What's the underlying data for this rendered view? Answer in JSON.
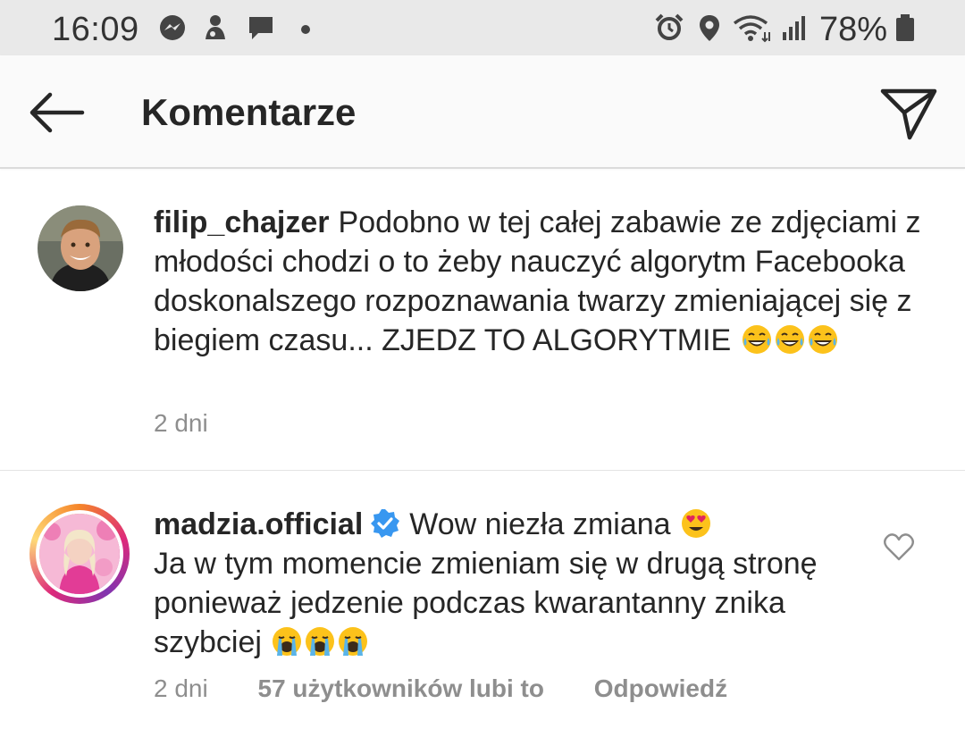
{
  "status_bar": {
    "time": "16:09",
    "battery": "78%",
    "icons": [
      "messenger-icon",
      "app-notification-icon",
      "message-icon",
      "dot-icon",
      "alarm-icon",
      "location-icon",
      "wifi-icon",
      "signal-icon",
      "battery-icon"
    ]
  },
  "header": {
    "title": "Komentarze",
    "back_icon": "back-arrow-icon",
    "share_icon": "send-icon"
  },
  "comments": [
    {
      "username": "filip_chajzer",
      "text": "Podobno w tej całej zabawie ze zdjęciami z młodości chodzi o to żeby nauczyć algorytm Facebooka doskonalszego rozpoznawania twarzy zmieniającej się z biegiem czasu... ZJEDZ TO ALGORYTMIE",
      "emojis": [
        "tears-of-joy-emoji",
        "tears-of-joy-emoji",
        "tears-of-joy-emoji"
      ],
      "time": "2 dni"
    },
    {
      "username": "madzia.official",
      "verified": true,
      "text_line1": "Wow niezła zmiana",
      "emoji_line1": [
        "heart-eyes-emoji"
      ],
      "text": "Ja w tym momencie zmieniam się w drugą stronę ponieważ jedzenie podczas kwarantanny znika szybciej",
      "emojis": [
        "loudly-crying-emoji",
        "loudly-crying-emoji",
        "loudly-crying-emoji"
      ],
      "time": "2 dni",
      "likes": "57 użytkowników lubi to",
      "reply": "Odpowiedź"
    }
  ],
  "colors": {
    "verified": "#3897f0",
    "muted": "#8e8e8e",
    "text": "#262626"
  }
}
